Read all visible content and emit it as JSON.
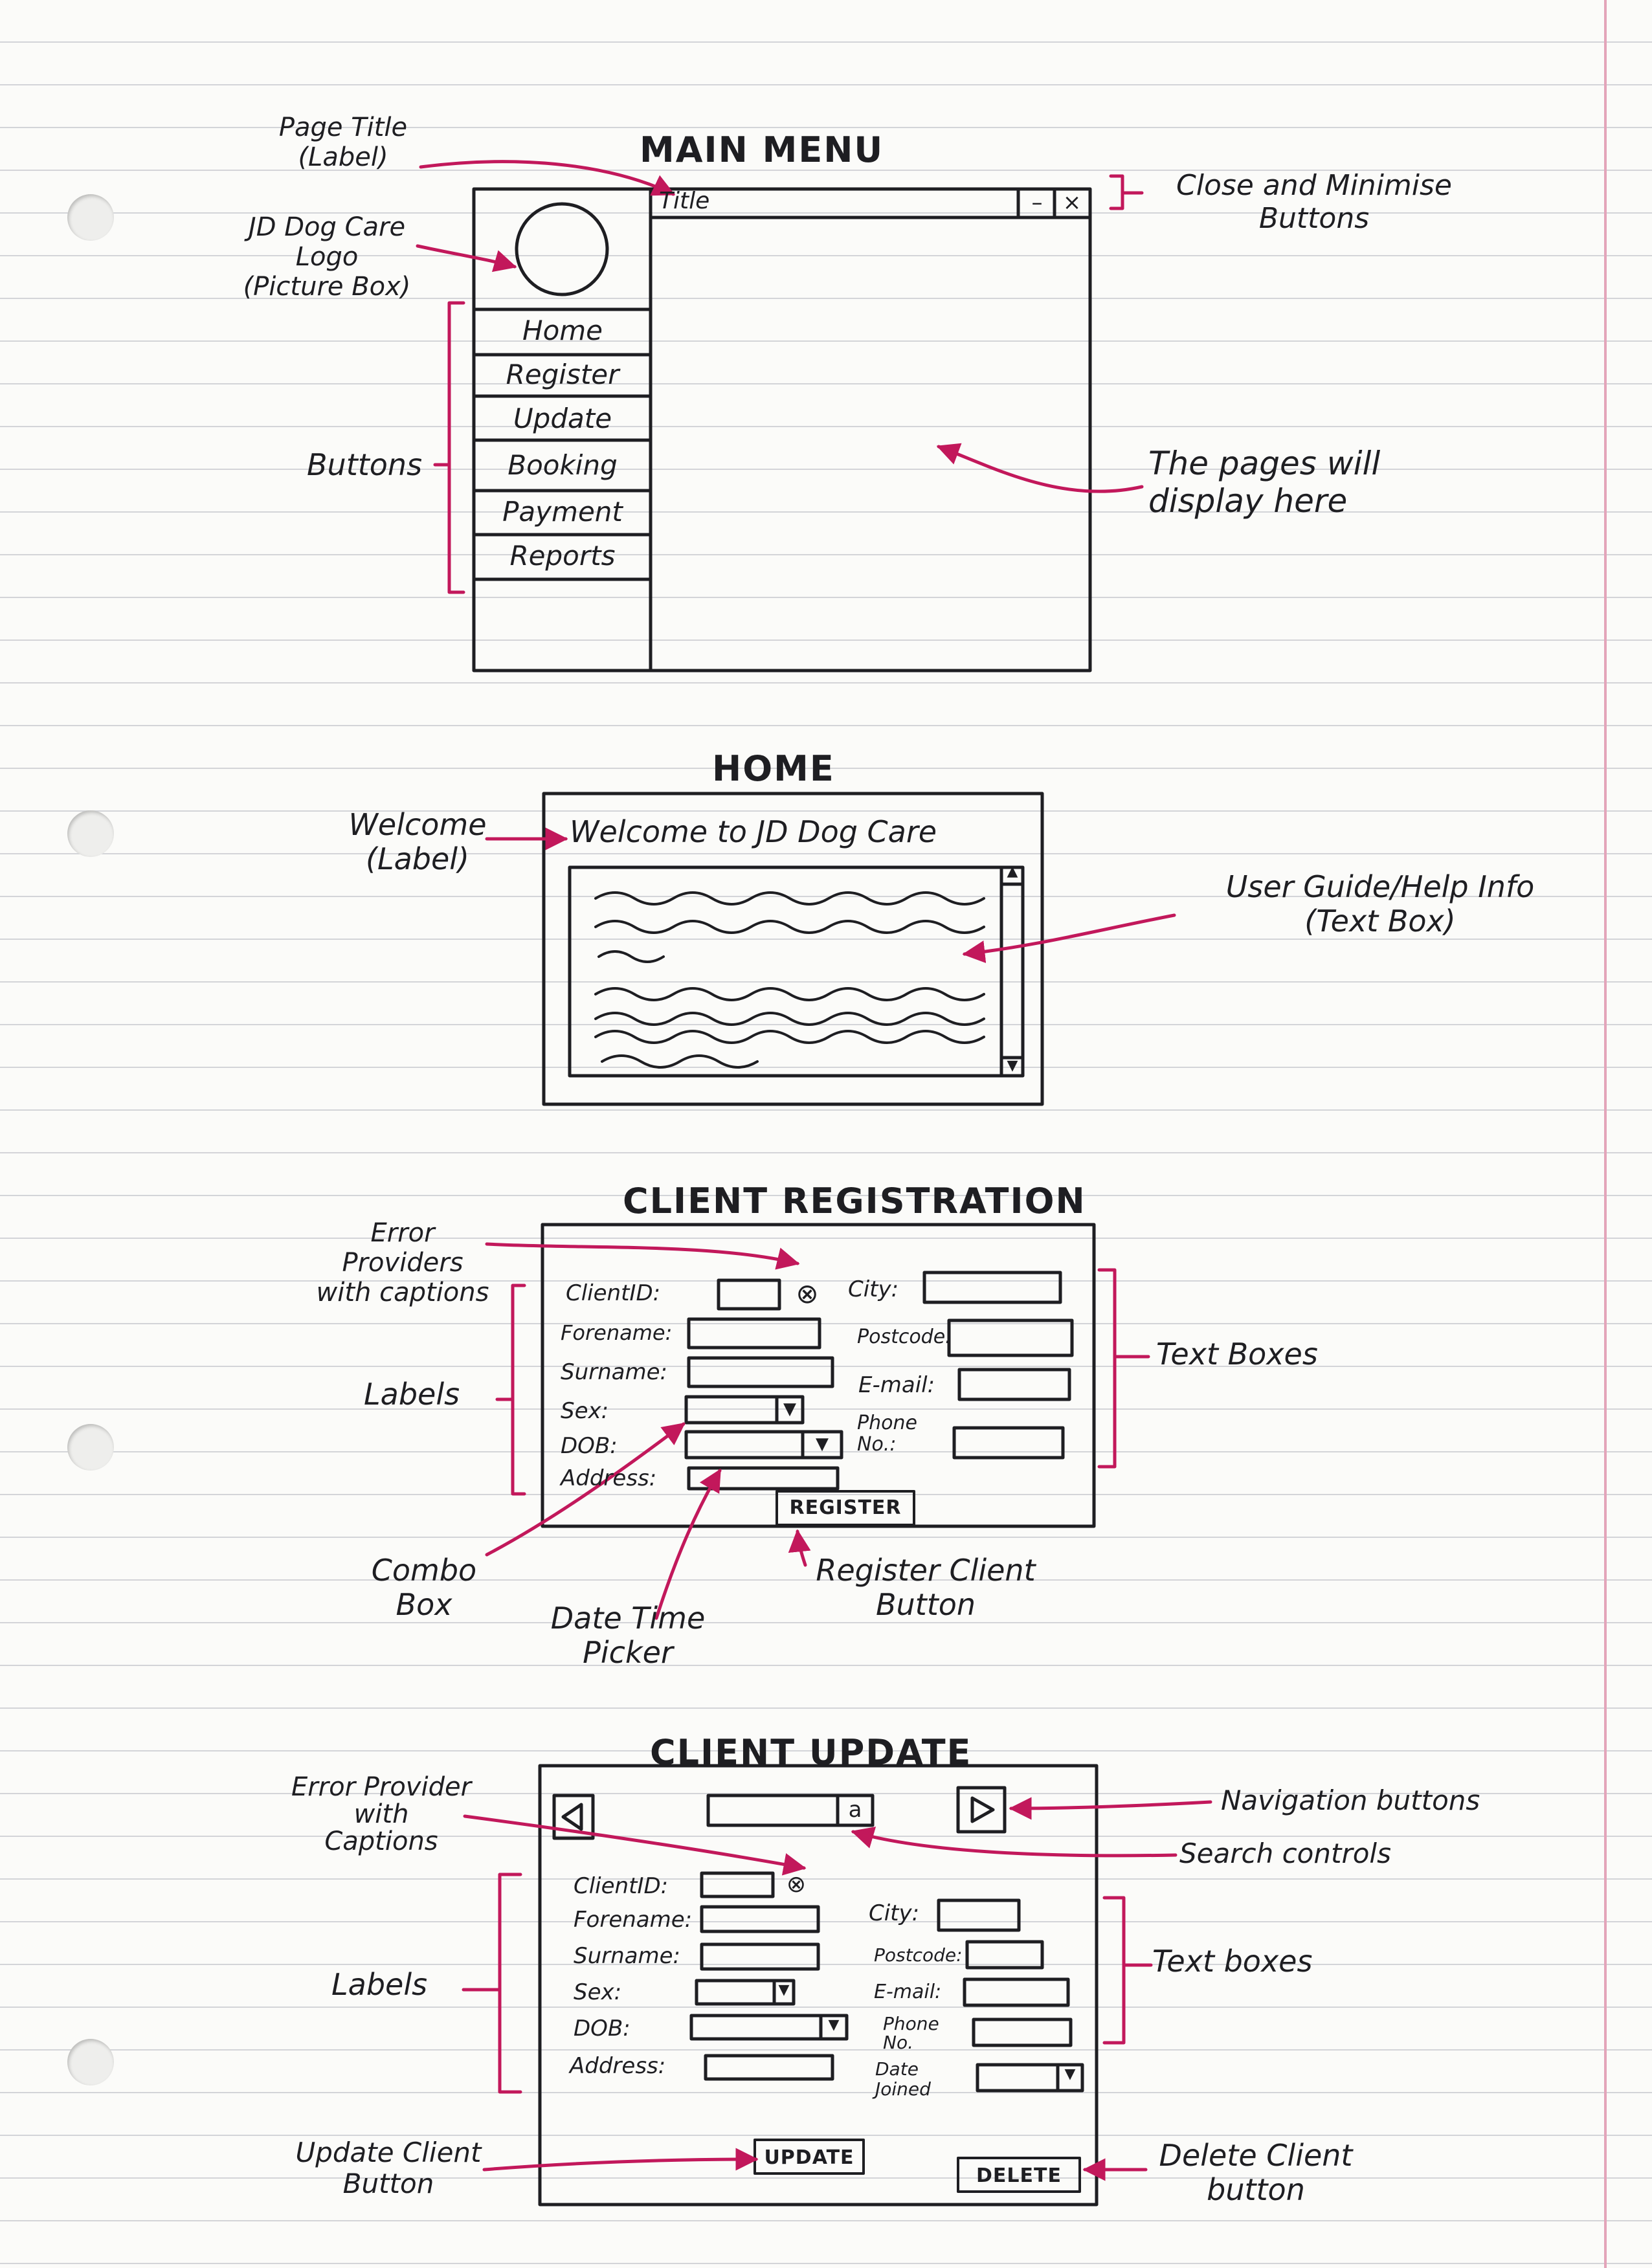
{
  "colors": {
    "ink": "#1e1e22",
    "annotation": "#c2185b",
    "paper": "#fbfbf9",
    "rule": "#d3d4d8",
    "margin": "#e3a5ba"
  },
  "main_menu": {
    "heading": "MAIN MENU",
    "title_label": "Title",
    "window_buttons": {
      "minimise": "–",
      "close": "×"
    },
    "logo_icon": "circle-logo",
    "sidebar_buttons": [
      "Home",
      "Register",
      "Update",
      "Booking",
      "Payment",
      "Reports"
    ],
    "annotations": {
      "page_title": "Page Title\n(Label)",
      "logo": "JD Dog Care\nLogo\n(Picture Box)",
      "buttons": "Buttons",
      "close_minimise": "Close and Minimise\nButtons",
      "pages": "The pages will\ndisplay here"
    }
  },
  "home": {
    "heading": "HOME",
    "welcome_text": "Welcome to JD Dog Care",
    "annotations": {
      "welcome": "Welcome\n(Label)",
      "user_guide": "User Guide/Help Info\n(Text Box)"
    }
  },
  "registration": {
    "heading": "CLIENT REGISTRATION",
    "labels": {
      "client_id": "ClientID:",
      "forename": "Forename:",
      "surname": "Surname:",
      "sex": "Sex:",
      "dob": "DOB:",
      "address": "Address:",
      "city": "City:",
      "postcode": "Postcode:",
      "email": "E-mail:",
      "phone": "Phone\nNo.:"
    },
    "register_button": "REGISTER",
    "error_icon": "error-circle-x",
    "annotations": {
      "error": "Error\nProviders\nwith captions",
      "labels": "Labels",
      "text_boxes": "Text Boxes",
      "combo": "Combo\nBox",
      "dtp": "Date Time\nPicker",
      "register": "Register Client\nButton"
    }
  },
  "update": {
    "heading": "CLIENT UPDATE",
    "labels": {
      "client_id": "ClientID:",
      "forename": "Forename:",
      "surname": "Surname:",
      "sex": "Sex:",
      "dob": "DOB:",
      "address": "Address:",
      "city": "City:",
      "postcode": "Postcode:",
      "email": "E-mail:",
      "phone": "Phone\nNo.",
      "date_joined": "Date\nJoined"
    },
    "search_button": "a",
    "update_button": "UPDATE",
    "delete_button": "DELETE",
    "annotations": {
      "error": "Error Provider\nwith\nCaptions",
      "navigation": "Navigation buttons",
      "search": "Search controls",
      "labels": "Labels",
      "text_boxes": "Text boxes",
      "update": "Update Client\nButton",
      "delete": "Delete Client\nbutton"
    }
  }
}
